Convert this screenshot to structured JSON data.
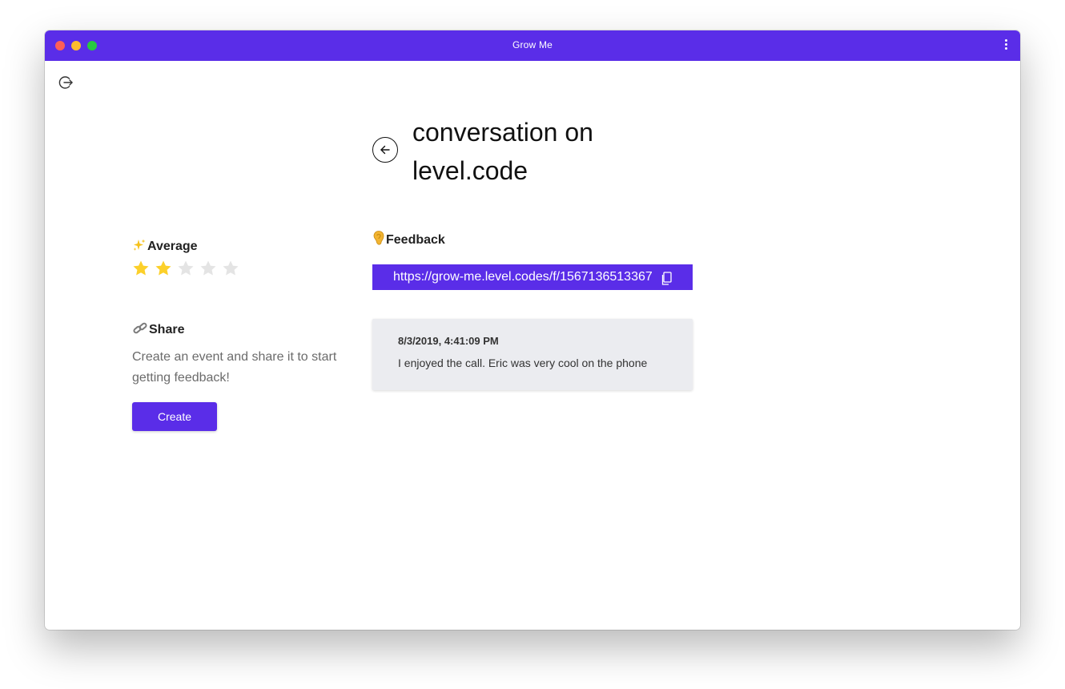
{
  "window": {
    "title": "Grow Me"
  },
  "page": {
    "title": "conversation on level.code"
  },
  "average": {
    "title": "Average",
    "rating": 2,
    "max_rating": 5,
    "star_color": "#fcd02a",
    "star_empty_color": "#e4e4e4"
  },
  "share": {
    "title": "Share",
    "description": "Create an event and share it to start getting feedback!",
    "create_label": "Create"
  },
  "feedback": {
    "title": "Feedback",
    "link": "https://grow-me.level.codes/f/1567136513367",
    "items": [
      {
        "date": "8/3/2019, 4:41:09 PM",
        "text": "I enjoyed the call. Eric was very cool on the phone"
      }
    ]
  },
  "colors": {
    "accent": "#5a2de8",
    "card_bg": "#ebecf0"
  },
  "icons": {
    "logout": "logout-icon",
    "back": "arrow-left-icon",
    "copy": "copy-icon",
    "sparkles": "sparkles-icon",
    "link": "link-icon",
    "ear": "ear-icon",
    "menu": "kebab-menu-icon"
  }
}
